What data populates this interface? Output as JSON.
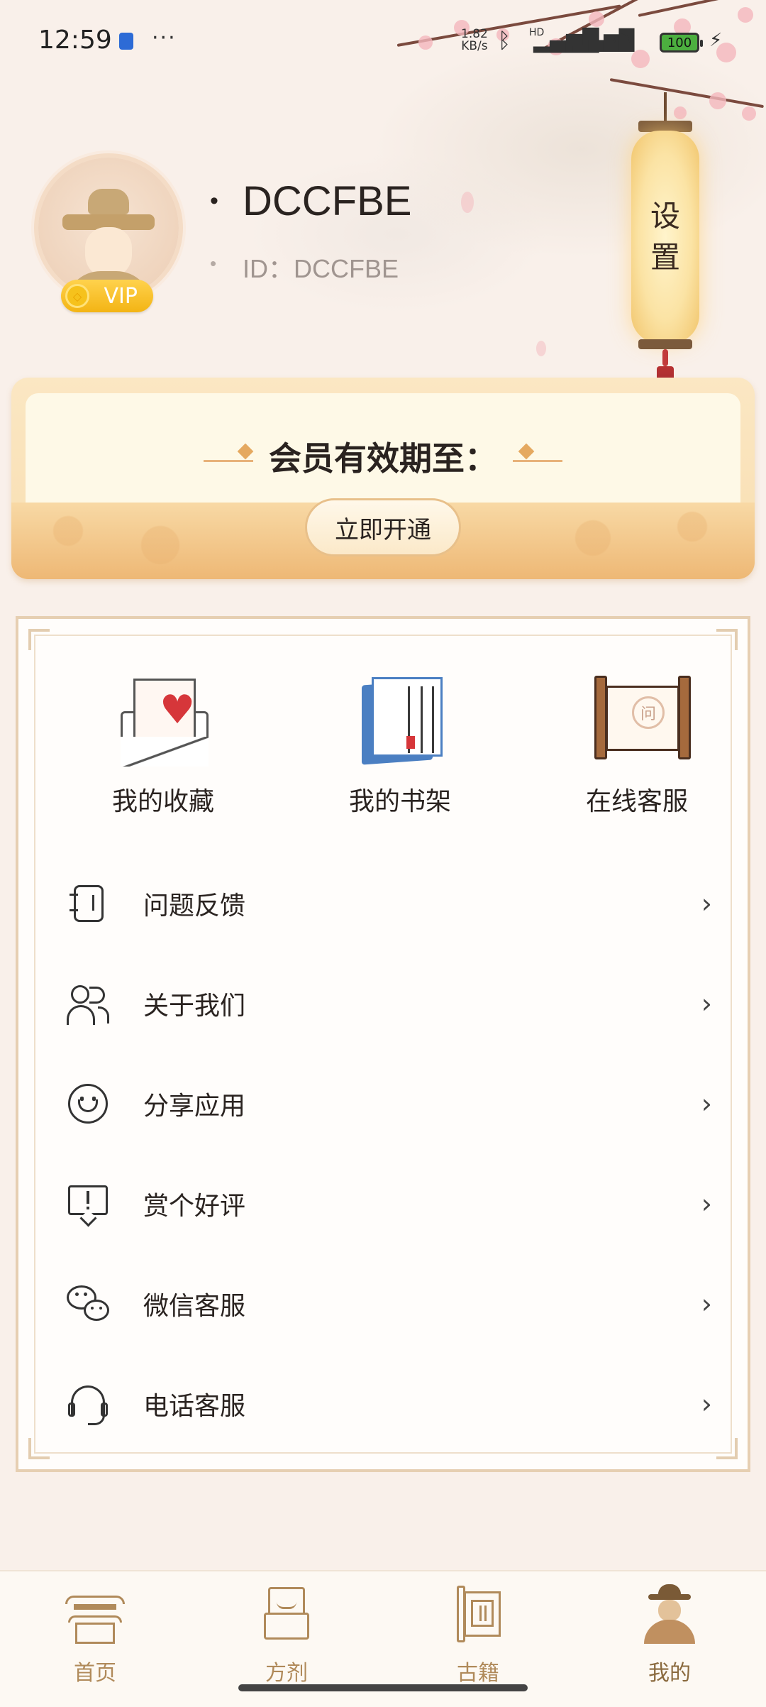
{
  "status_bar": {
    "time": "12:59",
    "net_speed": "1.82",
    "net_unit": "KB/s",
    "hd_label": "HD",
    "battery": "100"
  },
  "profile": {
    "username": "DCCFBE",
    "id_text": "ID：DCCFBE",
    "vip_label": "VIP"
  },
  "settings": {
    "label_line1": "设",
    "label_line2": "置"
  },
  "membership": {
    "title": "会员有效期至：",
    "button_label": "立即开通"
  },
  "shortcuts": [
    {
      "label": "我的收藏",
      "icon": "envelope-heart-icon"
    },
    {
      "label": "我的书架",
      "icon": "book-icon"
    },
    {
      "label": "在线客服",
      "icon": "scroll-icon",
      "scroll_char": "问"
    }
  ],
  "menu": [
    {
      "label": "问题反馈",
      "icon": "notebook-icon"
    },
    {
      "label": "关于我们",
      "icon": "users-icon"
    },
    {
      "label": "分享应用",
      "icon": "smile-icon"
    },
    {
      "label": "赏个好评",
      "icon": "comment-alert-icon"
    },
    {
      "label": "微信客服",
      "icon": "wechat-icon"
    },
    {
      "label": "电话客服",
      "icon": "headset-icon"
    }
  ],
  "tabs": [
    {
      "label": "首页",
      "icon": "temple-icon"
    },
    {
      "label": "方剂",
      "icon": "prescription-icon"
    },
    {
      "label": "古籍",
      "icon": "ancient-book-icon"
    },
    {
      "label": "我的",
      "icon": "profile-icon",
      "active": true
    }
  ]
}
